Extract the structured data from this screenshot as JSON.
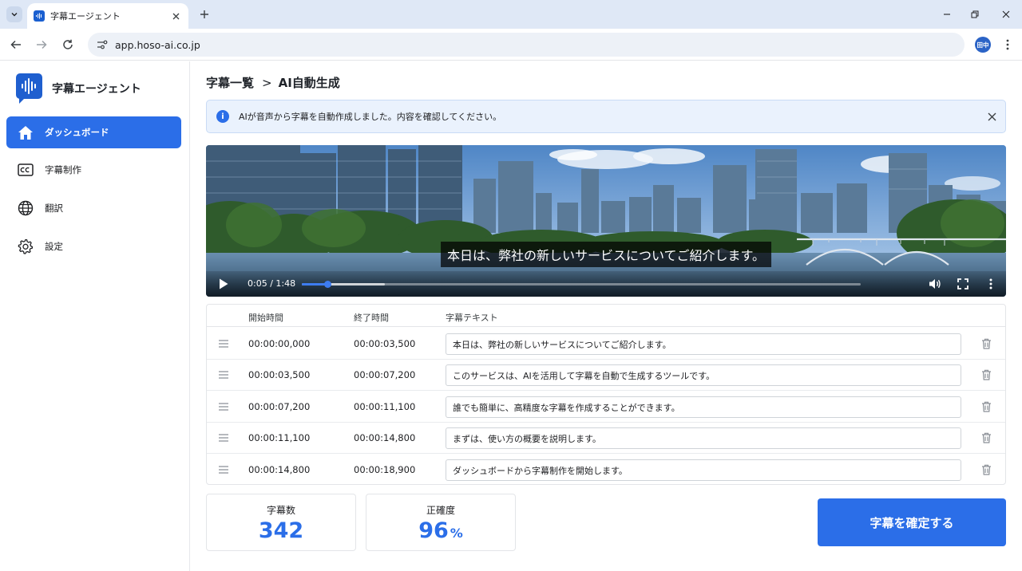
{
  "browser": {
    "tab_title": "字幕エージェント",
    "url": "app.hoso-ai.co.jp",
    "profile_initials": "田中"
  },
  "sidebar": {
    "brand": "字幕エージェント",
    "items": [
      {
        "label": "ダッシュボード",
        "icon": "home-icon",
        "active": true
      },
      {
        "label": "字幕制作",
        "icon": "closed-caption-icon",
        "active": false
      },
      {
        "label": "翻訳",
        "icon": "globe-icon",
        "active": false
      },
      {
        "label": "設定",
        "icon": "gear-icon",
        "active": false
      }
    ]
  },
  "breadcrumb": {
    "parent": "字幕一覧",
    "separator": ">",
    "current": "AI自動生成"
  },
  "alert": {
    "message": "AIが音声から字幕を自動作成しました。内容を確認してください。"
  },
  "video": {
    "caption": "本日は、弊社の新しいサービスについてご紹介します。",
    "time_display": "0:05 / 1:48",
    "played_fraction": 0.046,
    "buffered_fraction": 0.148
  },
  "table": {
    "headers": {
      "start": "開始時間",
      "end": "終了時間",
      "text": "字幕テキスト"
    },
    "rows": [
      {
        "start": "00:00:00,000",
        "end": "00:00:03,500",
        "text": "本日は、弊社の新しいサービスについてご紹介します。"
      },
      {
        "start": "00:00:03,500",
        "end": "00:00:07,200",
        "text": "このサービスは、AIを活用して字幕を自動で生成するツールです。"
      },
      {
        "start": "00:00:07,200",
        "end": "00:00:11,100",
        "text": "誰でも簡単に、高精度な字幕を作成することができます。"
      },
      {
        "start": "00:00:11,100",
        "end": "00:00:14,800",
        "text": "まずは、使い方の概要を説明します。"
      },
      {
        "start": "00:00:14,800",
        "end": "00:00:18,900",
        "text": "ダッシュボードから字幕制作を開始します。"
      }
    ]
  },
  "stats": {
    "count_label": "字幕数",
    "count_value": "342",
    "accuracy_label": "正確度",
    "accuracy_value": "96",
    "accuracy_unit": "%"
  },
  "actions": {
    "confirm_label": "字幕を確定する"
  },
  "colors": {
    "accent": "#2b6ee8",
    "alert_bg": "#eaf2fd"
  }
}
